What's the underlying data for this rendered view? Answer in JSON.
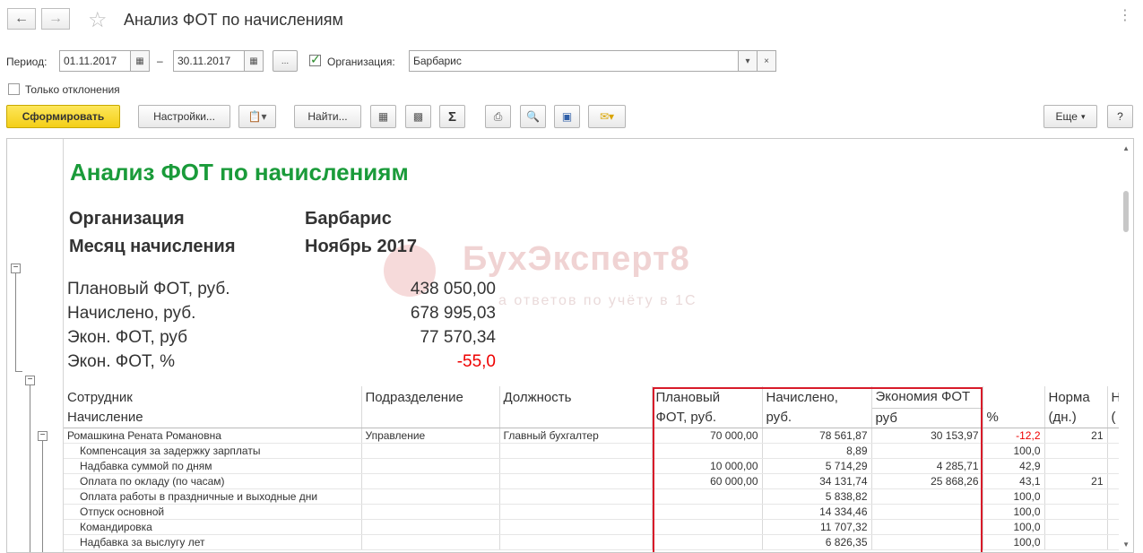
{
  "window": {
    "title": "Анализ ФОТ по начислениям"
  },
  "filters": {
    "period_label": "Период:",
    "date_from": "01.11.2017",
    "dash": "–",
    "date_to": "30.11.2017",
    "dots": "...",
    "org_label": "Организация:",
    "org_value": "Барбарис",
    "only_deviations": "Только отклонения"
  },
  "toolbar": {
    "generate": "Сформировать",
    "settings": "Настройки...",
    "find": "Найти...",
    "more": "Еще",
    "help": "?"
  },
  "report": {
    "title": "Анализ ФОТ по начислениям",
    "org_label": "Организация",
    "org_value": "Барбарис",
    "month_label": "Месяц начисления",
    "month_value": "Ноябрь 2017",
    "summary": [
      {
        "label": "Плановый ФОТ, руб.",
        "value": "438 050,00",
        "negative": false
      },
      {
        "label": "Начислено, руб.",
        "value": "678 995,03",
        "negative": false
      },
      {
        "label": "Экон. ФОТ, руб",
        "value": "77 570,34",
        "negative": false
      },
      {
        "label": "Экон. ФОТ, %",
        "value": "-55,0",
        "negative": true
      }
    ],
    "watermark": "БухЭксперт8",
    "watermark_sub": "а ответов по учёту в 1С",
    "columns": {
      "employee": "Сотрудник",
      "accrual": "Начисление",
      "department": "Подразделение",
      "position": "Должность",
      "plan_1": "Плановый",
      "plan_2": "ФОТ, руб.",
      "accrued_1": "Начислено,",
      "accrued_2": "руб.",
      "economy_1": "Экономия ФОТ",
      "economy_2": "руб",
      "pct": "%",
      "norm_1": "Норма",
      "norm_2": "(дн.)",
      "extra_1": "Н",
      "extra_2": "("
    },
    "employee_row": {
      "name": "Ромашкина Рената Романовна",
      "department": "Управление",
      "position": "Главный бухгалтер",
      "plan": "70 000,00",
      "accrued": "78 561,87",
      "economy": "30 153,97",
      "pct": "-12,2",
      "norm": "21"
    },
    "rows": [
      {
        "name": "Компенсация за задержку зарплаты",
        "plan": "",
        "accrued": "8,89",
        "economy": "",
        "pct": "100,0",
        "norm": ""
      },
      {
        "name": "Надбавка суммой по дням",
        "plan": "10 000,00",
        "accrued": "5 714,29",
        "economy": "4 285,71",
        "pct": "42,9",
        "norm": ""
      },
      {
        "name": "Оплата по окладу (по часам)",
        "plan": "60 000,00",
        "accrued": "34 131,74",
        "economy": "25 868,26",
        "pct": "43,1",
        "norm": "21"
      },
      {
        "name": "Оплата работы в праздничные и выходные дни",
        "plan": "",
        "accrued": "5 838,82",
        "economy": "",
        "pct": "100,0",
        "norm": ""
      },
      {
        "name": "Отпуск основной",
        "plan": "",
        "accrued": "14 334,46",
        "economy": "",
        "pct": "100,0",
        "norm": ""
      },
      {
        "name": "Командировка",
        "plan": "",
        "accrued": "11 707,32",
        "economy": "",
        "pct": "100,0",
        "norm": ""
      },
      {
        "name": "Надбавка за выслугу лет",
        "plan": "",
        "accrued": "6 826,35",
        "economy": "",
        "pct": "100,0",
        "norm": ""
      }
    ]
  }
}
